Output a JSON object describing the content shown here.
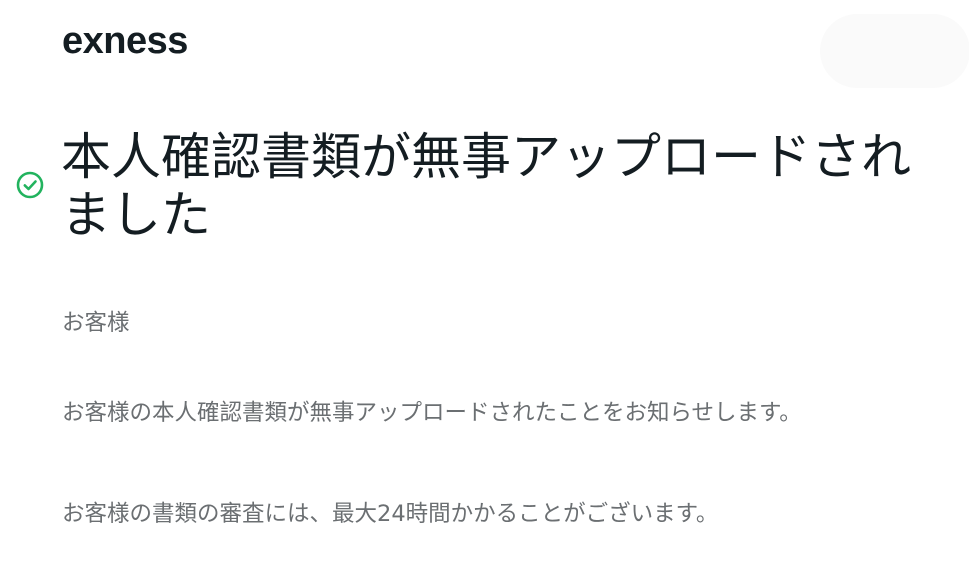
{
  "header": {
    "logo_text": "exness"
  },
  "status": {
    "icon": "check-circle-icon",
    "color": "#22b35e"
  },
  "title": "本人確認書類が無事アップロードされました",
  "body": {
    "greeting": "お客様",
    "paragraph_1": "お客様の本人確認書類が無事アップロードされたことをお知らせします。",
    "paragraph_2": "お客様の書類の審査には、最大24時間かかることがございます。"
  }
}
